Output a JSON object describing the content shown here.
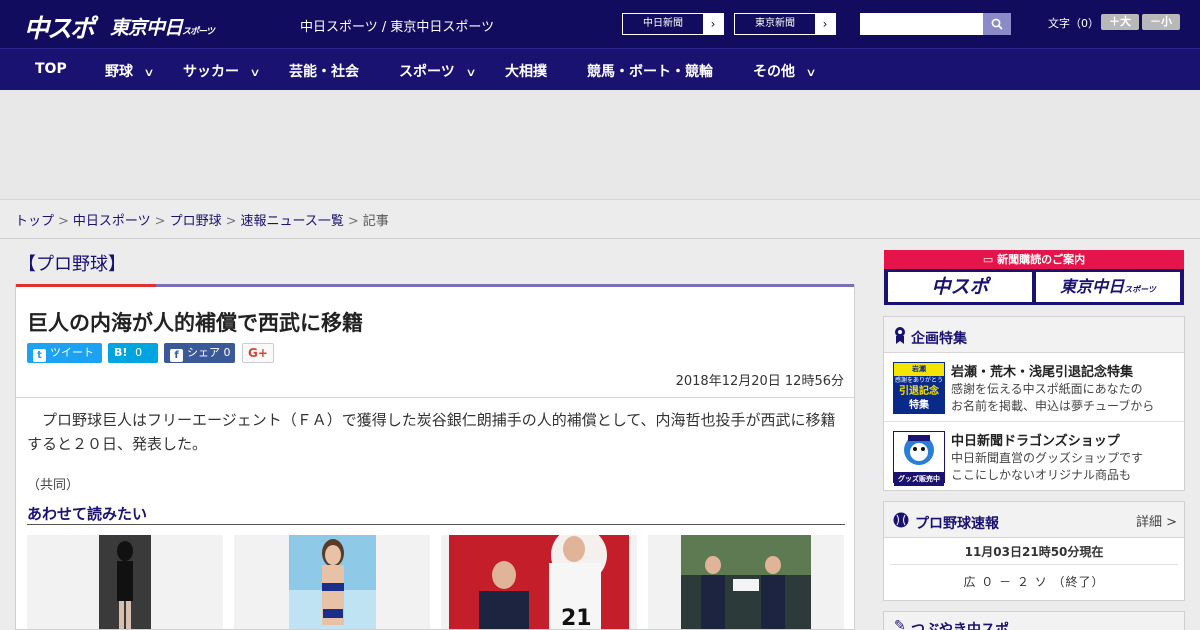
{
  "header": {
    "logo_chuspo": "中スポ",
    "logo_tokyo": "東京中日",
    "logo_tokyo_small": "スポーツ",
    "site_name": "中日スポーツ / 東京中日スポーツ",
    "np_buttons": [
      "中日新聞",
      "東京新聞"
    ],
    "search_placeholder": "",
    "fontsize_label": "文字（0）",
    "fontsize_plus": "＋大",
    "fontsize_minus": "－小"
  },
  "nav": {
    "items": [
      {
        "label": "TOP",
        "dropdown": false
      },
      {
        "label": "野球",
        "dropdown": true
      },
      {
        "label": "サッカー",
        "dropdown": true
      },
      {
        "label": "芸能・社会",
        "dropdown": false
      },
      {
        "label": "スポーツ",
        "dropdown": true
      },
      {
        "label": "大相撲",
        "dropdown": false
      },
      {
        "label": "競馬・ボート・競輪",
        "dropdown": false
      },
      {
        "label": "その他",
        "dropdown": true
      }
    ]
  },
  "breadcrumb": {
    "items": [
      "トップ",
      "中日スポーツ",
      "プロ野球",
      "速報ニュース一覧"
    ],
    "current": "記事"
  },
  "article": {
    "category": "【プロ野球】",
    "headline": "巨人の内海が人的補償で西武に移籍",
    "share": {
      "tweet_label": "ツイート",
      "hatena_label": "B!",
      "hatena_count": "0",
      "facebook_label": "シェア",
      "facebook_count": "0",
      "gplus_label": "G+"
    },
    "date": "2018年12月20日 12時56分",
    "body": "プロ野球巨人はフリーエージェント（ＦＡ）で獲得した炭谷銀仁朗捕手の人的補償として、内海哲也投手が西武に移籍すると２０日、発表した。",
    "credit": "（共同）",
    "related_heading": "あわせて読みたい",
    "thumb_jersey_number": "21"
  },
  "sidebar": {
    "subscription": {
      "heading": "新聞購読のご案内",
      "buttons": [
        "中スポ",
        "東京中日"
      ],
      "tokyo_small": "スポーツ"
    },
    "features": {
      "title": "企画特集",
      "items": [
        {
          "title": "岩瀬・荒木・浅尾引退記念特集",
          "desc1": "感謝を伝える中スポ紙面にあなたの",
          "desc2": "お名前を掲載、申込は夢チューブから",
          "img_text": [
            "岩瀬",
            "感謝をありがとう",
            "引退記念",
            "特集"
          ]
        },
        {
          "title": "中日新聞ドラゴンズショップ",
          "desc1": "中日新聞直営のグッズショップです",
          "desc2": "ここにしかないオリジナル商品も",
          "img_text": [
            "グッズ販売中"
          ]
        }
      ]
    },
    "scores": {
      "title": "プロ野球速報",
      "detail_label": "詳細 >",
      "time": "11月03日21時50分現在",
      "line": "広 ０ － ２ ソ （終了）"
    },
    "next_panel_title": "つぶやき中スポ"
  },
  "colors": {
    "header_bg": "#120c5e",
    "nav_bg": "#1a1270",
    "accent_red": "#e5154b",
    "twitter": "#1da1f2",
    "hatena": "#00a4de",
    "facebook": "#3b5998"
  }
}
